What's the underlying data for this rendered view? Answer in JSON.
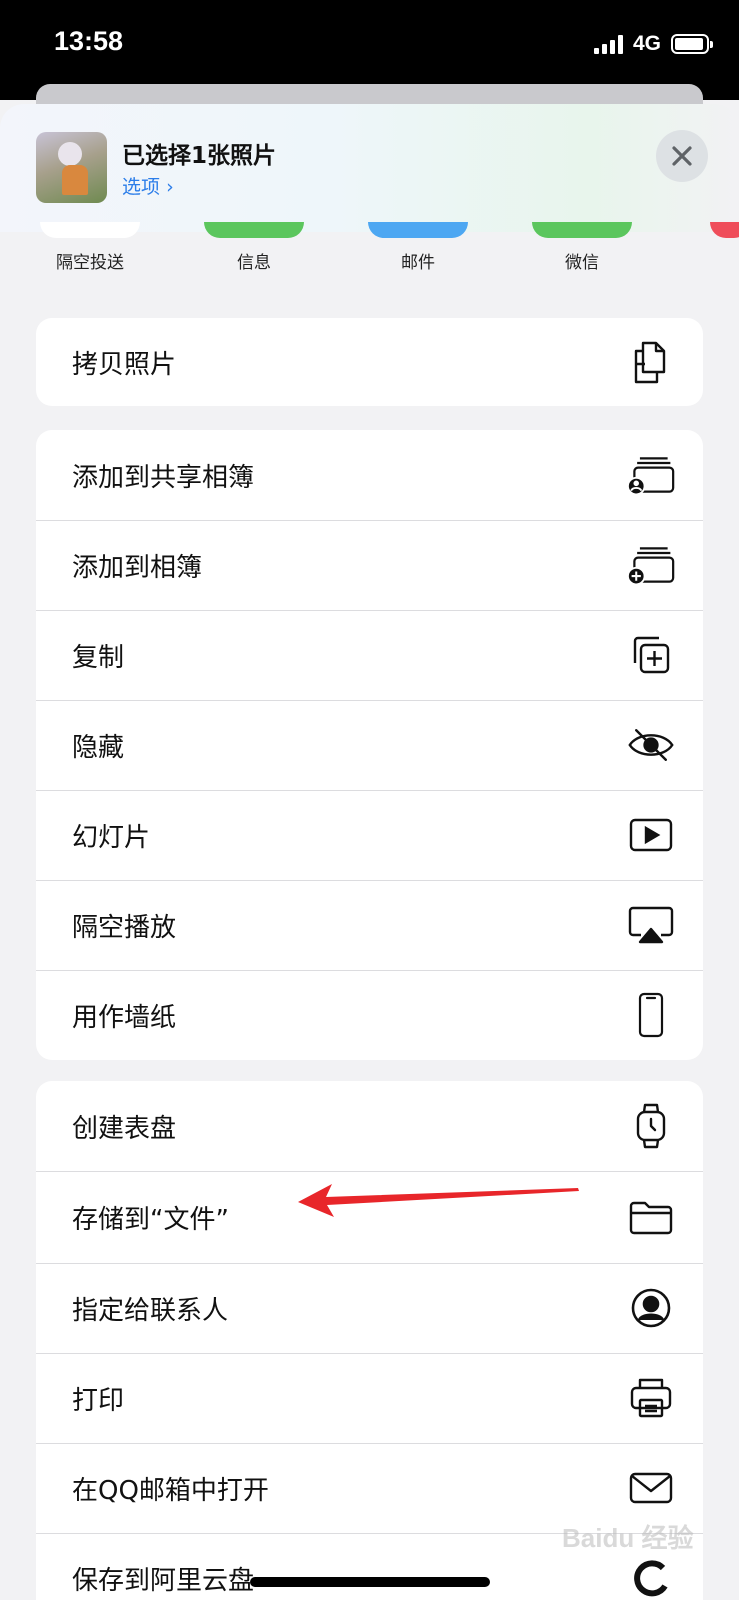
{
  "status_bar": {
    "time": "13:58",
    "network": "4G"
  },
  "share_header": {
    "title": "已选择1张照片",
    "options_label": "选项",
    "options_chevron": "›"
  },
  "apps": [
    {
      "label": "隔空投送",
      "color": "#ffffff"
    },
    {
      "label": "信息",
      "color": "#5bc65d"
    },
    {
      "label": "邮件",
      "color": "#4da7f2"
    },
    {
      "label": "微信",
      "color": "#5bc65d"
    }
  ],
  "actions": {
    "group1": [
      {
        "label": "拷贝照片",
        "icon": "copy-icon"
      }
    ],
    "group2": [
      {
        "label": "添加到共享相簿",
        "icon": "shared-album-icon"
      },
      {
        "label": "添加到相簿",
        "icon": "add-album-icon"
      },
      {
        "label": "复制",
        "icon": "duplicate-icon"
      },
      {
        "label": "隐藏",
        "icon": "eye-slash-icon"
      },
      {
        "label": "幻灯片",
        "icon": "play-icon"
      },
      {
        "label": "隔空播放",
        "icon": "airplay-icon"
      },
      {
        "label": "用作墙纸",
        "icon": "iphone-icon"
      }
    ],
    "group3": [
      {
        "label": "创建表盘",
        "icon": "watch-icon"
      },
      {
        "label": "存储到“文件”",
        "icon": "folder-icon"
      },
      {
        "label": "指定给联系人",
        "icon": "contact-icon"
      },
      {
        "label": "打印",
        "icon": "printer-icon"
      },
      {
        "label": "在QQ邮箱中打开",
        "icon": "mail-icon"
      },
      {
        "label": "保存到阿里云盘",
        "icon": "cloud-app-icon"
      }
    ]
  },
  "annotation": {
    "arrow_color": "#e8262a"
  },
  "watermark": "Baidu 经验"
}
